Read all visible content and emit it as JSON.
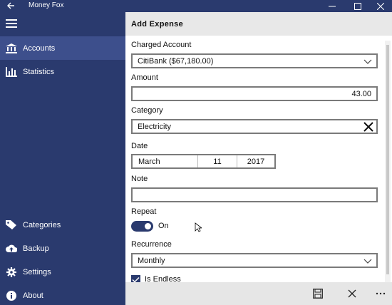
{
  "window": {
    "title": "Money Fox"
  },
  "sidebar": {
    "items": [
      {
        "label": "Accounts",
        "icon": "bank-icon"
      },
      {
        "label": "Statistics",
        "icon": "bar-chart-icon"
      },
      {
        "label": "Categories",
        "icon": "tag-icon"
      },
      {
        "label": "Backup",
        "icon": "cloud-upload-icon"
      },
      {
        "label": "Settings",
        "icon": "gear-icon"
      },
      {
        "label": "About",
        "icon": "info-icon"
      }
    ]
  },
  "page": {
    "title": "Add Expense"
  },
  "form": {
    "charged_account_label": "Charged Account",
    "charged_account_value": "CitiBank ($67,180.00)",
    "amount_label": "Amount",
    "amount_value": "43.00",
    "category_label": "Category",
    "category_value": "Electricity",
    "date_label": "Date",
    "date_month": "March",
    "date_day": "11",
    "date_year": "2017",
    "note_label": "Note",
    "note_value": "",
    "repeat_label": "Repeat",
    "repeat_state": "On",
    "recurrence_label": "Recurrence",
    "recurrence_value": "Monthly",
    "is_endless_label": "Is Endless",
    "is_endless_checked": true
  },
  "colors": {
    "accent": "#2a3a6e",
    "active_item": "#3d4f8c"
  }
}
